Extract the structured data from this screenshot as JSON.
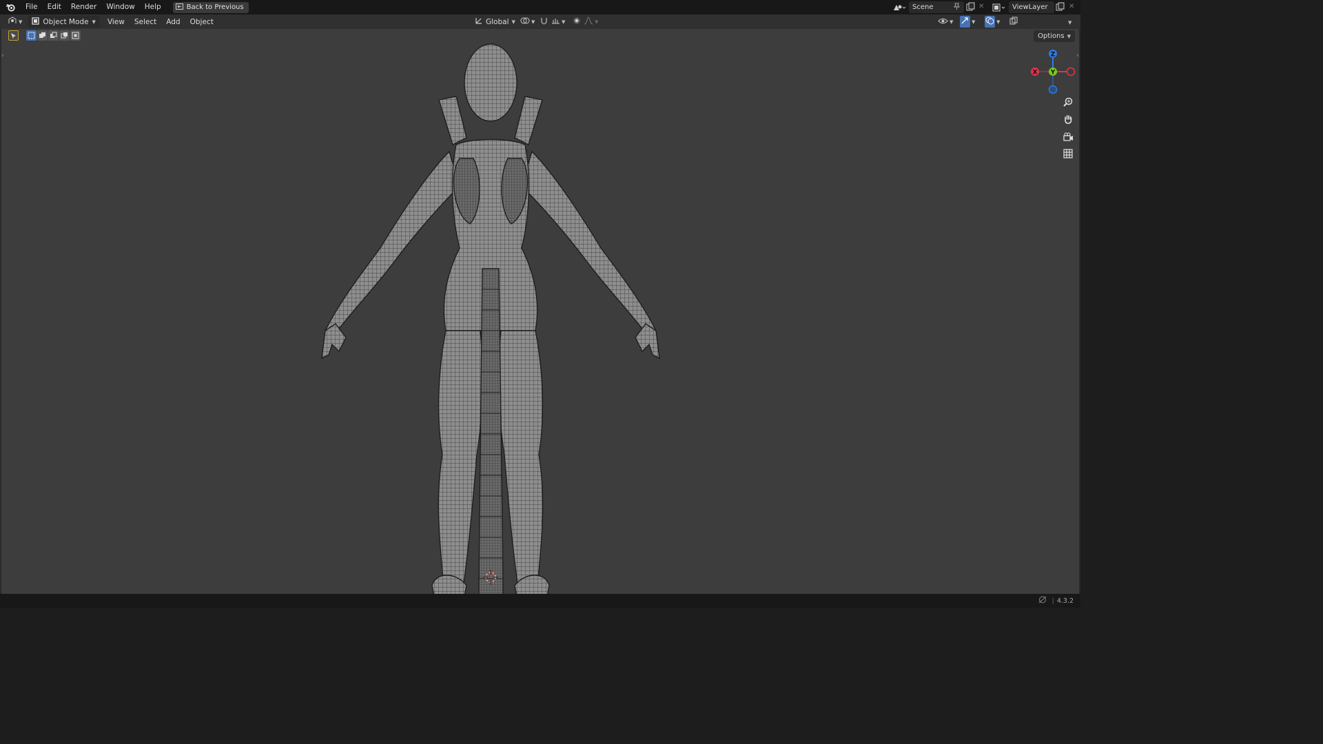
{
  "topbar": {
    "menus": [
      "File",
      "Edit",
      "Render",
      "Window",
      "Help"
    ],
    "back_label": "Back to Previous",
    "scene_label": "Scene",
    "viewlayer_label": "ViewLayer"
  },
  "header": {
    "mode_label": "Object Mode",
    "menus": [
      "View",
      "Select",
      "Add",
      "Object"
    ],
    "orientation_label": "Global"
  },
  "viewport": {
    "options_label": "Options",
    "gizmo": {
      "z_label": "Z",
      "y_label": "Y",
      "x_label": "X"
    },
    "background_color": "#3d3d3d",
    "mesh_color": "#8a8a8a"
  },
  "statusbar": {
    "version": "4.3.2"
  },
  "colors": {
    "axis_x": "#e2334b",
    "axis_y": "#7cc71c",
    "axis_z": "#2d7be0",
    "active_shading": "#5b8fd6"
  }
}
